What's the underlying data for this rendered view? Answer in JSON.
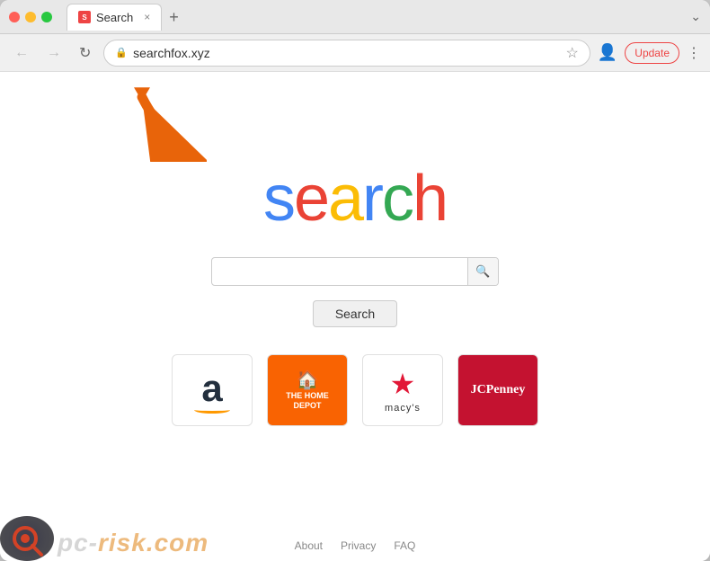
{
  "browser": {
    "title": "Search",
    "url": "searchfox.xyz",
    "tab_close": "×",
    "tab_new": "+",
    "update_label": "Update",
    "chevron": "⌄"
  },
  "toolbar": {
    "back_label": "←",
    "forward_label": "→",
    "refresh_label": "↻",
    "star_label": "☆",
    "lock_icon": "🔒"
  },
  "page": {
    "logo_letters": [
      "s",
      "e",
      "a",
      "r",
      "c",
      "h"
    ],
    "search_placeholder": "",
    "search_button_label": "Search",
    "shortcuts": [
      {
        "name": "Amazon",
        "type": "amazon"
      },
      {
        "name": "The Home Depot",
        "type": "homedepot"
      },
      {
        "name": "Macy's",
        "type": "macys"
      },
      {
        "name": "JCPenney",
        "type": "jcpenney"
      }
    ],
    "footer_links": [
      "About",
      "Privacy",
      "FAQ"
    ]
  },
  "watermark": {
    "text_plain": "pc-",
    "text_colored": "risk.com"
  }
}
